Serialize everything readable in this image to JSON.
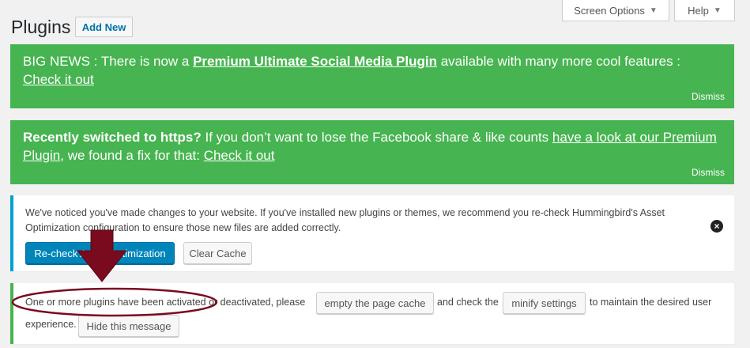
{
  "header": {
    "screen_options": "Screen Options",
    "help": "Help",
    "caret": "▼",
    "title": "Plugins",
    "add_new": "Add New"
  },
  "notice1": {
    "prefix": "BIG NEWS : There is now a ",
    "link": "Premium Ultimate Social Media Plugin",
    "suffix": " available with many more cool features :",
    "cta": "Check it out",
    "dismiss": "Dismiss"
  },
  "notice2": {
    "bold": "Recently switched to https?",
    "text": " If you don’t want to lose the Facebook share & like counts ",
    "link1": "have a look at our Premium Plugin",
    "text2": ", we found a fix for that: ",
    "link2": "Check it out",
    "dismiss": "Dismiss"
  },
  "notice3": {
    "text": "We've noticed you've made changes to your website. If you've installed new plugins or themes, we recommend you re-check Hummingbird's Asset Optimization configuration to ensure those new files are added correctly.",
    "recheck": "Re-check Asset Optimization",
    "clear_cache": "Clear Cache",
    "close": "×"
  },
  "notice4": {
    "text_a": "One or more plugins have been activated or deactivated, please",
    "empty_cache": "empty the page cache",
    "text_b": "and check the",
    "minify": "minify settings",
    "text_c": "to maintain the desired user",
    "text_d": "experience.",
    "hide": "Hide this message"
  },
  "colors": {
    "green": "#46b450",
    "blue_accent": "#00a0d2",
    "primary_button": "#0085ba",
    "annotation": "#7a0a1e"
  },
  "annotation": {
    "arrow": "down-arrow",
    "ellipse": "highlight-ellipse"
  }
}
